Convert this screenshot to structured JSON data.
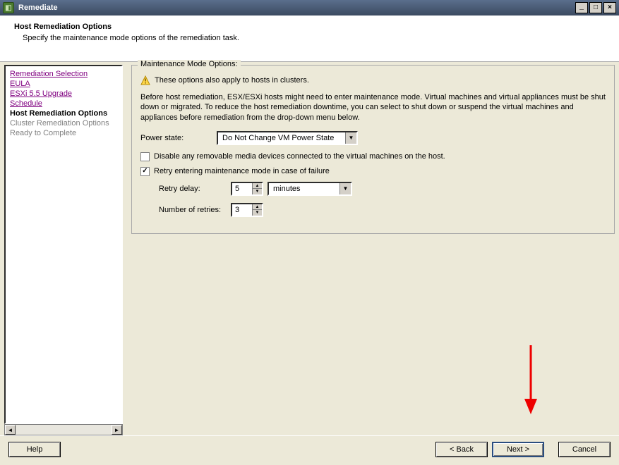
{
  "window": {
    "title": "Remediate"
  },
  "header": {
    "title": "Host Remediation Options",
    "subtitle": "Specify the maintenance mode options of the remediation task."
  },
  "sidebar": {
    "items": [
      {
        "label": "Remediation Selection",
        "state": "visited"
      },
      {
        "label": "EULA",
        "state": "visited"
      },
      {
        "label": "ESXi 5.5 Upgrade",
        "state": "visited"
      },
      {
        "label": "Schedule",
        "state": "visited"
      },
      {
        "label": "Host Remediation Options",
        "state": "current"
      },
      {
        "label": "Cluster Remediation Options",
        "state": "disabled"
      },
      {
        "label": "Ready to Complete",
        "state": "disabled"
      }
    ]
  },
  "main": {
    "group_legend": "Maintenance Mode Options:",
    "cluster_note": "These options also apply to hosts in clusters.",
    "info_text": "Before host remediation, ESX/ESXi hosts might need to enter maintenance mode. Virtual machines and virtual appliances must be shut down or migrated. To reduce the host remediation downtime, you can select to shut down or suspend the virtual machines and appliances before remediation from the drop-down menu below.",
    "power_state_label": "Power state:",
    "power_state_value": "Do Not Change VM Power State",
    "disable_media_label": "Disable any removable media devices connected to the virtual machines on the host.",
    "disable_media_checked": false,
    "retry_label": "Retry entering maintenance mode in case of failure",
    "retry_checked": true,
    "retry_delay_label": "Retry delay:",
    "retry_delay_value": "5",
    "retry_delay_unit": "minutes",
    "num_retries_label": "Number of retries:",
    "num_retries_value": "3"
  },
  "footer": {
    "help": "Help",
    "back": "< Back",
    "next": "Next >",
    "cancel": "Cancel"
  }
}
